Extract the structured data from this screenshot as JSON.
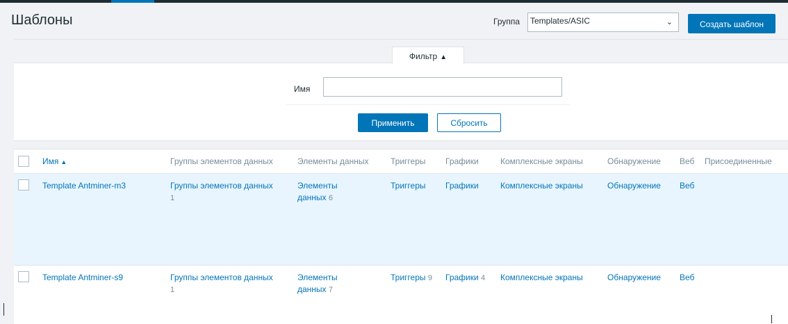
{
  "header": {
    "title": "Шаблоны",
    "group_label": "Группа",
    "group_value": "Templates/ASIC",
    "create_button": "Создать шаблон"
  },
  "filter": {
    "tab_label": "Фильтр",
    "tab_arrow": "▲",
    "name_label": "Имя",
    "name_value": "",
    "apply_button": "Применить",
    "reset_button": "Сбросить"
  },
  "table": {
    "columns": [
      {
        "label": "Имя",
        "sort_arrow": "▲"
      },
      {
        "label": "Группы элементов данных"
      },
      {
        "label": "Элементы данных"
      },
      {
        "label": "Триггеры"
      },
      {
        "label": "Графики"
      },
      {
        "label": "Комплексные экраны"
      },
      {
        "label": "Обнаружение"
      },
      {
        "label": "Веб"
      },
      {
        "label": "Присоединенные"
      }
    ],
    "rows": [
      {
        "name": "Template Antminer-m3",
        "app_groups": "Группы элементов данных",
        "app_groups_count": "1",
        "items": "Элементы данных",
        "items_count": "6",
        "triggers": "Триггеры",
        "triggers_count": "",
        "graphs": "Графики",
        "graphs_count": "",
        "screens": "Комплексные экраны",
        "discovery": "Обнаружение",
        "web": "Веб"
      },
      {
        "name": "Template Antminer-s9",
        "app_groups": "Группы элементов данных",
        "app_groups_count": "1",
        "items": "Элементы данных",
        "items_count": "7",
        "triggers": "Триггеры",
        "triggers_count": "9",
        "graphs": "Графики",
        "graphs_count": "4",
        "screens": "Комплексные экраны",
        "discovery": "Обнаружение",
        "web": "Веб"
      }
    ]
  },
  "icons": {
    "select_chevron": "chevron-down-icon",
    "sort_arrow": "sort-up-icon"
  },
  "colors": {
    "accent": "#0275b8",
    "selected_row": "#e8f5ff",
    "header_text": "#768d99",
    "page_bg": "#f0f2f5"
  }
}
